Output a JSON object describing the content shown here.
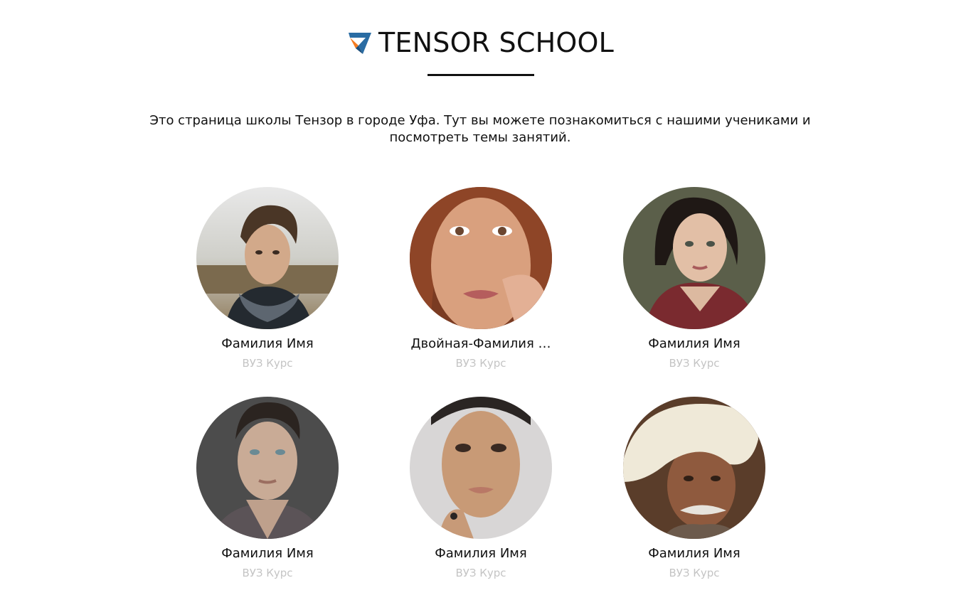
{
  "header": {
    "title": "TENSOR SCHOOL",
    "logo_icon": "tensor-logo-icon",
    "logo_colors": {
      "primary": "#2a6ca3",
      "accent": "#f47b20"
    }
  },
  "intro": {
    "text": "Это страница школы Тензор в городе Уфа. Тут вы можете познакомиться с нашими учениками и посмотреть темы занятий."
  },
  "students": [
    {
      "name": "Фамилия Имя",
      "meta": "ВУЗ Курс",
      "photo": "student-photo-man-scarf"
    },
    {
      "name": "Двойная-Фамилия …",
      "meta": "ВУЗ Курс",
      "photo": "student-photo-redhead-freckles"
    },
    {
      "name": "Фамилия Имя",
      "meta": "ВУЗ Курс",
      "photo": "student-photo-woman-short-hair"
    },
    {
      "name": "Фамилия Имя",
      "meta": "ВУЗ Курс",
      "photo": "student-photo-man-freckles"
    },
    {
      "name": "Фамилия Имя",
      "meta": "ВУЗ Курс",
      "photo": "student-photo-woman-bald"
    },
    {
      "name": "Фамилия Имя",
      "meta": "ВУЗ Курс",
      "photo": "student-photo-old-man-turban"
    }
  ]
}
